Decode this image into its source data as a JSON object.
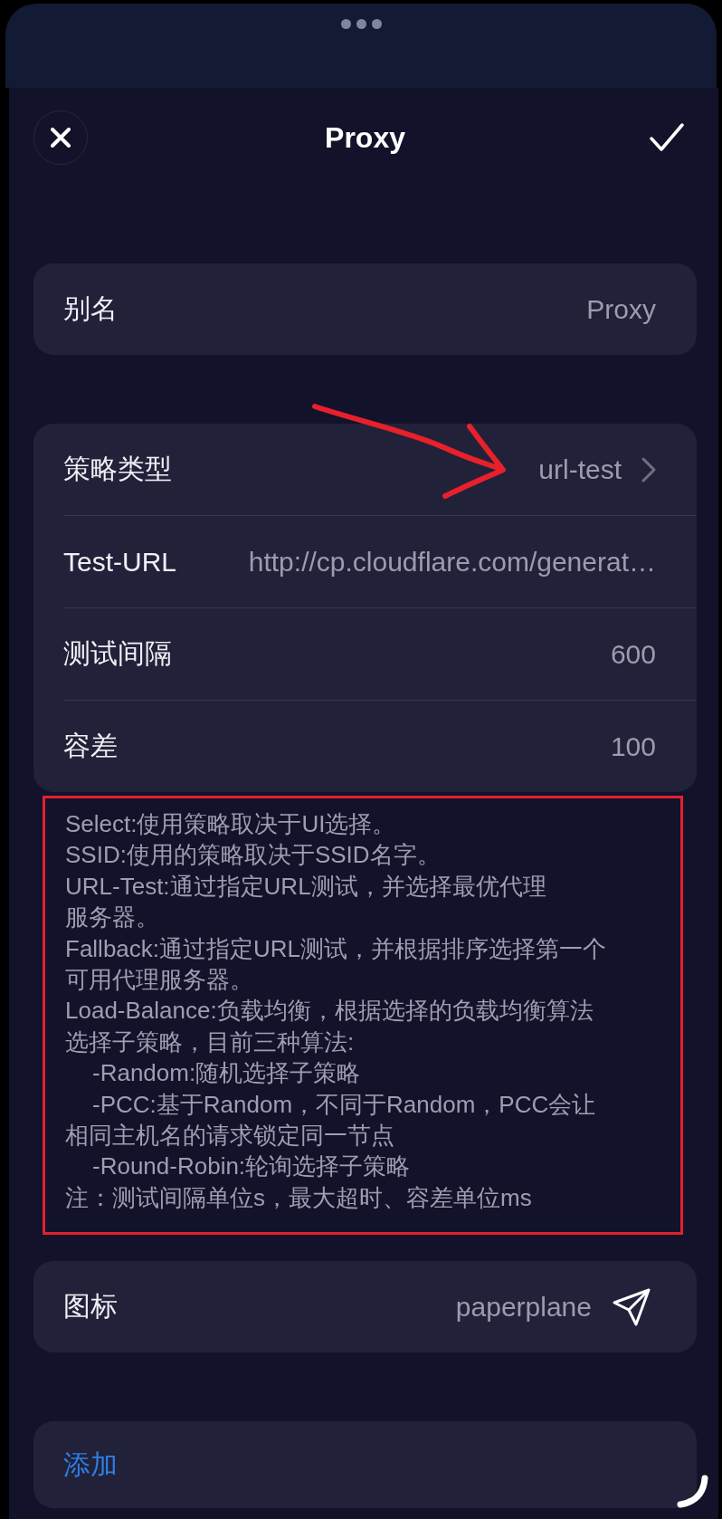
{
  "header": {
    "title": "Proxy"
  },
  "sections": [
    {
      "kind": "card",
      "rows": [
        {
          "kind": "text",
          "label": "别名",
          "value": "Proxy"
        }
      ]
    },
    {
      "kind": "card",
      "rows": [
        {
          "kind": "picker",
          "label": "策略类型",
          "value": "url-test"
        },
        {
          "kind": "text",
          "label": "Test-URL",
          "value": "http://cp.cloudflare.com/generat…"
        },
        {
          "kind": "text",
          "label": "测试间隔",
          "value": "600"
        },
        {
          "kind": "text",
          "label": "容差",
          "value": "100"
        }
      ]
    },
    {
      "kind": "note",
      "entries": [
        {
          "lines": [
            "Select:使用策略取决于UI选择。"
          ]
        },
        {
          "lines": [
            "SSID:使用的策略取决于SSID名字。"
          ]
        },
        {
          "lines": [
            "URL-Test:通过指定URL测试，并选择最优代理",
            "服务器。"
          ]
        },
        {
          "lines": [
            "Fallback:通过指定URL测试，并根据排序选择第一个",
            "可用代理服务器。"
          ]
        },
        {
          "lines": [
            "Load-Balance:负载均衡，根据选择的负载均衡算法",
            "选择子策略，目前三种算法:"
          ],
          "children": [
            {
              "lines": [
                "-Random:随机选择子策略"
              ]
            },
            {
              "lines": [
                "-PCC:基于Random，不同于Random，PCC会让",
                "相同主机名的请求锁定同一节点"
              ]
            },
            {
              "lines": [
                "-Round-Robin:轮询选择子策略"
              ]
            }
          ]
        },
        {
          "lines": [
            "注：测试间隔单位s，最大超时、容差单位ms"
          ]
        }
      ]
    },
    {
      "kind": "card",
      "rows": [
        {
          "kind": "icon",
          "label": "图标",
          "value": "paperplane"
        }
      ]
    },
    {
      "kind": "button",
      "label": "添加"
    }
  ]
}
